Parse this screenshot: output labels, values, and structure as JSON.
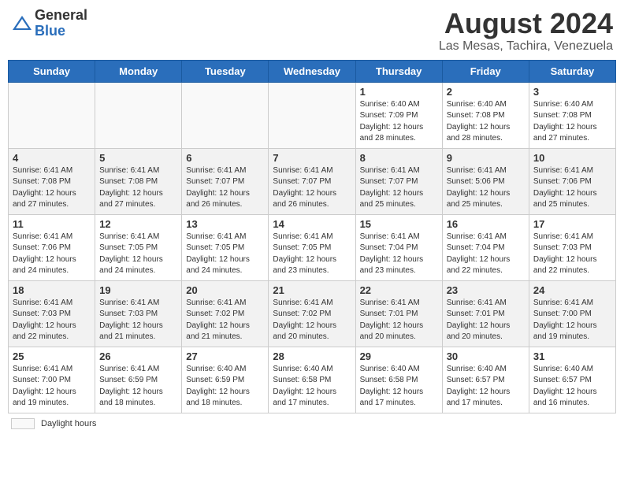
{
  "header": {
    "logo_general": "General",
    "logo_blue": "Blue",
    "month_title": "August 2024",
    "location": "Las Mesas, Tachira, Venezuela"
  },
  "days_of_week": [
    "Sunday",
    "Monday",
    "Tuesday",
    "Wednesday",
    "Thursday",
    "Friday",
    "Saturday"
  ],
  "weeks": [
    [
      {
        "num": "",
        "info": ""
      },
      {
        "num": "",
        "info": ""
      },
      {
        "num": "",
        "info": ""
      },
      {
        "num": "",
        "info": ""
      },
      {
        "num": "1",
        "info": "Sunrise: 6:40 AM\nSunset: 7:09 PM\nDaylight: 12 hours\nand 28 minutes."
      },
      {
        "num": "2",
        "info": "Sunrise: 6:40 AM\nSunset: 7:08 PM\nDaylight: 12 hours\nand 28 minutes."
      },
      {
        "num": "3",
        "info": "Sunrise: 6:40 AM\nSunset: 7:08 PM\nDaylight: 12 hours\nand 27 minutes."
      }
    ],
    [
      {
        "num": "4",
        "info": "Sunrise: 6:41 AM\nSunset: 7:08 PM\nDaylight: 12 hours\nand 27 minutes."
      },
      {
        "num": "5",
        "info": "Sunrise: 6:41 AM\nSunset: 7:08 PM\nDaylight: 12 hours\nand 27 minutes."
      },
      {
        "num": "6",
        "info": "Sunrise: 6:41 AM\nSunset: 7:07 PM\nDaylight: 12 hours\nand 26 minutes."
      },
      {
        "num": "7",
        "info": "Sunrise: 6:41 AM\nSunset: 7:07 PM\nDaylight: 12 hours\nand 26 minutes."
      },
      {
        "num": "8",
        "info": "Sunrise: 6:41 AM\nSunset: 7:07 PM\nDaylight: 12 hours\nand 25 minutes."
      },
      {
        "num": "9",
        "info": "Sunrise: 6:41 AM\nSunset: 5:06 PM\nDaylight: 12 hours\nand 25 minutes."
      },
      {
        "num": "10",
        "info": "Sunrise: 6:41 AM\nSunset: 7:06 PM\nDaylight: 12 hours\nand 25 minutes."
      }
    ],
    [
      {
        "num": "11",
        "info": "Sunrise: 6:41 AM\nSunset: 7:06 PM\nDaylight: 12 hours\nand 24 minutes."
      },
      {
        "num": "12",
        "info": "Sunrise: 6:41 AM\nSunset: 7:05 PM\nDaylight: 12 hours\nand 24 minutes."
      },
      {
        "num": "13",
        "info": "Sunrise: 6:41 AM\nSunset: 7:05 PM\nDaylight: 12 hours\nand 24 minutes."
      },
      {
        "num": "14",
        "info": "Sunrise: 6:41 AM\nSunset: 7:05 PM\nDaylight: 12 hours\nand 23 minutes."
      },
      {
        "num": "15",
        "info": "Sunrise: 6:41 AM\nSunset: 7:04 PM\nDaylight: 12 hours\nand 23 minutes."
      },
      {
        "num": "16",
        "info": "Sunrise: 6:41 AM\nSunset: 7:04 PM\nDaylight: 12 hours\nand 22 minutes."
      },
      {
        "num": "17",
        "info": "Sunrise: 6:41 AM\nSunset: 7:03 PM\nDaylight: 12 hours\nand 22 minutes."
      }
    ],
    [
      {
        "num": "18",
        "info": "Sunrise: 6:41 AM\nSunset: 7:03 PM\nDaylight: 12 hours\nand 22 minutes."
      },
      {
        "num": "19",
        "info": "Sunrise: 6:41 AM\nSunset: 7:03 PM\nDaylight: 12 hours\nand 21 minutes."
      },
      {
        "num": "20",
        "info": "Sunrise: 6:41 AM\nSunset: 7:02 PM\nDaylight: 12 hours\nand 21 minutes."
      },
      {
        "num": "21",
        "info": "Sunrise: 6:41 AM\nSunset: 7:02 PM\nDaylight: 12 hours\nand 20 minutes."
      },
      {
        "num": "22",
        "info": "Sunrise: 6:41 AM\nSunset: 7:01 PM\nDaylight: 12 hours\nand 20 minutes."
      },
      {
        "num": "23",
        "info": "Sunrise: 6:41 AM\nSunset: 7:01 PM\nDaylight: 12 hours\nand 20 minutes."
      },
      {
        "num": "24",
        "info": "Sunrise: 6:41 AM\nSunset: 7:00 PM\nDaylight: 12 hours\nand 19 minutes."
      }
    ],
    [
      {
        "num": "25",
        "info": "Sunrise: 6:41 AM\nSunset: 7:00 PM\nDaylight: 12 hours\nand 19 minutes."
      },
      {
        "num": "26",
        "info": "Sunrise: 6:41 AM\nSunset: 6:59 PM\nDaylight: 12 hours\nand 18 minutes."
      },
      {
        "num": "27",
        "info": "Sunrise: 6:40 AM\nSunset: 6:59 PM\nDaylight: 12 hours\nand 18 minutes."
      },
      {
        "num": "28",
        "info": "Sunrise: 6:40 AM\nSunset: 6:58 PM\nDaylight: 12 hours\nand 17 minutes."
      },
      {
        "num": "29",
        "info": "Sunrise: 6:40 AM\nSunset: 6:58 PM\nDaylight: 12 hours\nand 17 minutes."
      },
      {
        "num": "30",
        "info": "Sunrise: 6:40 AM\nSunset: 6:57 PM\nDaylight: 12 hours\nand 17 minutes."
      },
      {
        "num": "31",
        "info": "Sunrise: 6:40 AM\nSunset: 6:57 PM\nDaylight: 12 hours\nand 16 minutes."
      }
    ]
  ],
  "footer": {
    "legend_label": "Daylight hours"
  }
}
